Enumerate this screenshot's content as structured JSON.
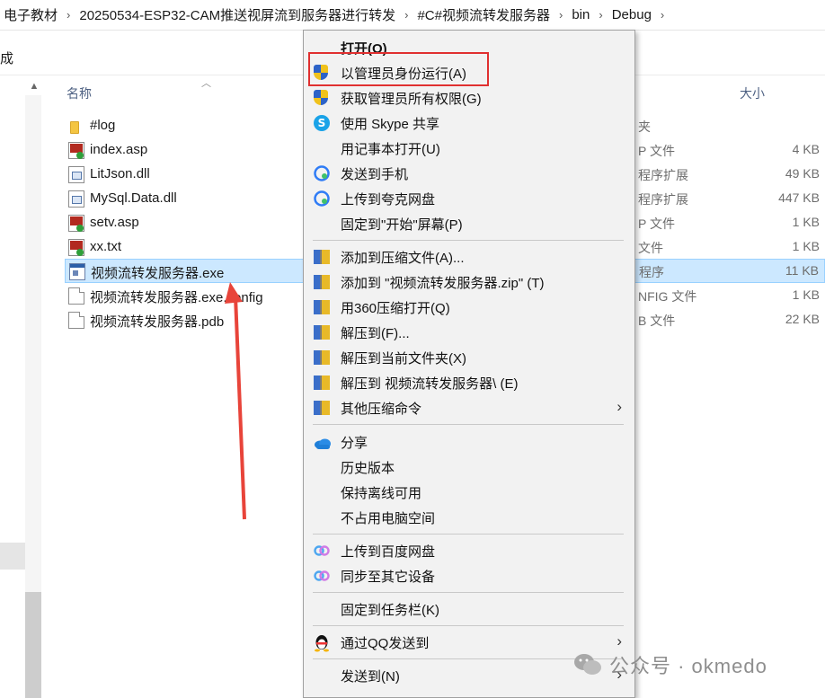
{
  "breadcrumb": [
    "电子教材",
    "20250534-ESP32-CAM推送视屏流到服务器进行转发",
    "#C#视频流转发服务器",
    "bin",
    "Debug"
  ],
  "toolbar": {
    "label": "完成"
  },
  "columns": {
    "name": "名称",
    "type_fragment": "",
    "size": "大小"
  },
  "files": [
    {
      "name": "#log",
      "icon": "folder-icon",
      "type": "夹",
      "size": ""
    },
    {
      "name": "index.asp",
      "icon": "asp-file-icon",
      "type": "P 文件",
      "size": "4 KB"
    },
    {
      "name": "LitJson.dll",
      "icon": "dll-file-icon",
      "type": "程序扩展",
      "size": "49 KB"
    },
    {
      "name": "MySql.Data.dll",
      "icon": "dll-file-icon",
      "type": "程序扩展",
      "size": "447 KB"
    },
    {
      "name": "setv.asp",
      "icon": "asp-file-icon",
      "type": "P 文件",
      "size": "1 KB"
    },
    {
      "name": "xx.txt",
      "icon": "asp-file-icon",
      "type": "文件",
      "size": "1 KB"
    },
    {
      "name": "视频流转发服务器.exe",
      "icon": "exe-file-icon",
      "type": "程序",
      "size": "11 KB",
      "selected": true
    },
    {
      "name": "视频流转发服务器.exe.config",
      "icon": "file-icon",
      "type": "NFIG 文件",
      "size": "1 KB"
    },
    {
      "name": "视频流转发服务器.pdb",
      "icon": "file-icon",
      "type": "B 文件",
      "size": "22 KB"
    }
  ],
  "menu": {
    "open": "打开(O)",
    "run_as_admin": "以管理员身份运行(A)",
    "take_ownership": "获取管理员所有权限(G)",
    "skype_share": "使用 Skype 共享",
    "open_notepad": "用记事本打开(U)",
    "send_to_phone": "发送到手机",
    "upload_quark": "上传到夸克网盘",
    "pin_start": "固定到\"开始\"屏幕(P)",
    "add_archive": "添加到压缩文件(A)...",
    "add_zip": "添加到 \"视频流转发服务器.zip\" (T)",
    "open_360": "用360压缩打开(Q)",
    "extract_to": "解压到(F)...",
    "extract_here": "解压到当前文件夹(X)",
    "extract_folder": "解压到 视频流转发服务器\\ (E)",
    "other_zip": "其他压缩命令",
    "share": "分享",
    "history": "历史版本",
    "keep_offline": "保持离线可用",
    "free_space": "不占用电脑空间",
    "upload_baidu": "上传到百度网盘",
    "sync_devices": "同步至其它设备",
    "pin_taskbar": "固定到任务栏(K)",
    "qq_send": "通过QQ发送到",
    "send_to": "发送到(N)"
  },
  "watermark": "公众号 · okmedo",
  "colors": {
    "highlight_box": "#e03030",
    "arrow": "#e8443a",
    "selection": "#cce8ff"
  }
}
